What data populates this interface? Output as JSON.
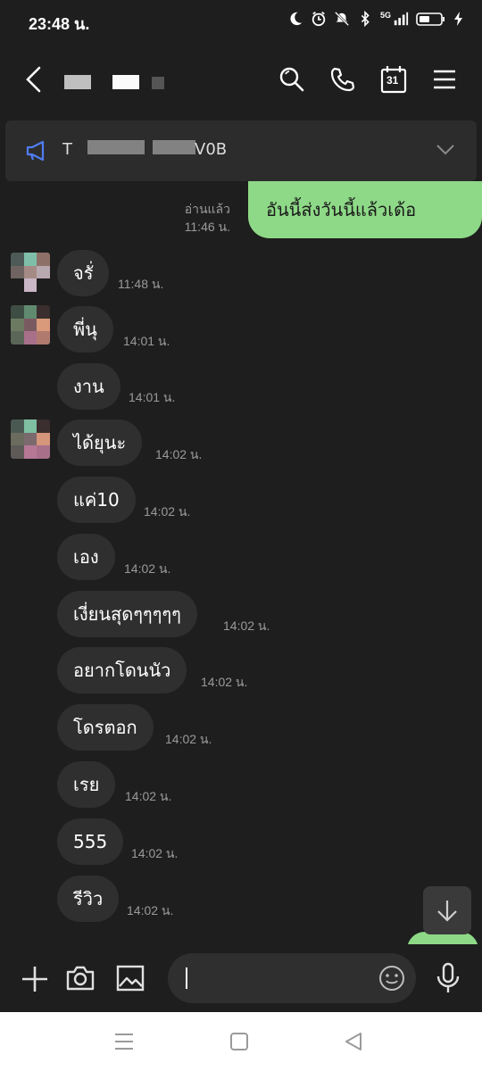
{
  "status_bar": {
    "time": "23:48 น.",
    "network": "5G",
    "icons": [
      "moon-icon",
      "alarm-icon",
      "mute-icon",
      "bluetooth-icon",
      "signal-icon",
      "battery-icon",
      "charging-icon"
    ]
  },
  "header": {
    "contact_name": "",
    "icons": [
      "back-icon",
      "search-icon",
      "phone-icon",
      "calendar-icon",
      "menu-icon"
    ],
    "calendar_day": "31"
  },
  "announcement": {
    "text_start": "T",
    "text_end": "V0B",
    "icons": [
      "megaphone-icon",
      "chevron-down-icon"
    ]
  },
  "messages": [
    {
      "direction": "out",
      "text": "อันนี้ส่งวันนี้แล้วเด้อ",
      "read_label": "อ่านแล้ว",
      "time": "11:46 น."
    },
    {
      "direction": "in",
      "text": "จรั่",
      "time": "11:48 น."
    },
    {
      "direction": "in",
      "text": "พี่นุ",
      "time": "14:01 น."
    },
    {
      "direction": "in",
      "text": "งาน",
      "time": "14:01 น."
    },
    {
      "direction": "in",
      "text": "ได้ยุนะ",
      "time": "14:02 น."
    },
    {
      "direction": "in",
      "text": "แค่10",
      "time": "14:02 น."
    },
    {
      "direction": "in",
      "text": "เอง",
      "time": "14:02 น."
    },
    {
      "direction": "in",
      "text": "เงี่ยนสุดๆๆๆๆๆ",
      "time": "14:02 น."
    },
    {
      "direction": "in",
      "text": "อยากโดนนัว",
      "time": "14:02 น."
    },
    {
      "direction": "in",
      "text": "โดรตอก",
      "time": "14:02 น."
    },
    {
      "direction": "in",
      "text": "เรย",
      "time": "14:02 น."
    },
    {
      "direction": "in",
      "text": "555",
      "time": "14:02 น."
    },
    {
      "direction": "in",
      "text": "รีวิว",
      "time": "14:02 น."
    }
  ],
  "input_bar": {
    "placeholder": "",
    "icons": [
      "plus-icon",
      "camera-icon",
      "image-icon",
      "emoji-icon",
      "microphone-icon"
    ]
  },
  "scroll_down_icon": "arrow-down-icon",
  "nav_bar": {
    "icons": [
      "recents-icon",
      "home-icon",
      "back-nav-icon"
    ]
  },
  "colors": {
    "background": "#1e1e1e",
    "bubble_in": "#2f2f2f",
    "bubble_out": "#8ed987",
    "timestamp": "#9a9a9a",
    "accent_blue": "#4f7df0"
  }
}
